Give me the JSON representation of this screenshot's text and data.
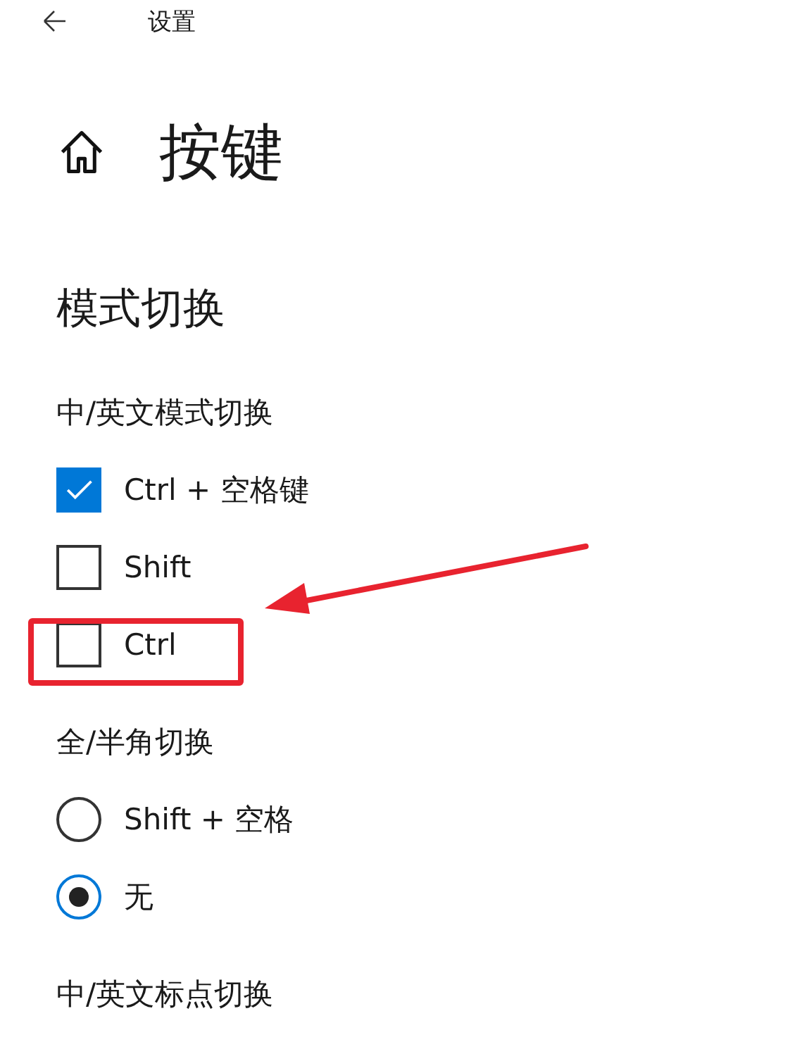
{
  "window": {
    "title": "设置"
  },
  "page": {
    "title": "按键"
  },
  "section": {
    "title": "模式切换"
  },
  "groups": [
    {
      "label": "中/英文模式切换",
      "options": [
        {
          "kind": "checkbox",
          "label": "Ctrl + 空格键",
          "checked": true,
          "highlighted": false
        },
        {
          "kind": "checkbox",
          "label": "Shift",
          "checked": false,
          "highlighted": false
        },
        {
          "kind": "checkbox",
          "label": "Ctrl",
          "checked": false,
          "highlighted": true
        }
      ]
    },
    {
      "label": "全/半角切换",
      "options": [
        {
          "kind": "radio",
          "label": "Shift + 空格",
          "selected": false,
          "highlighted": false
        },
        {
          "kind": "radio",
          "label": "无",
          "selected": true,
          "highlighted": false
        }
      ]
    },
    {
      "label": "中/英文标点切换"
    }
  ]
}
